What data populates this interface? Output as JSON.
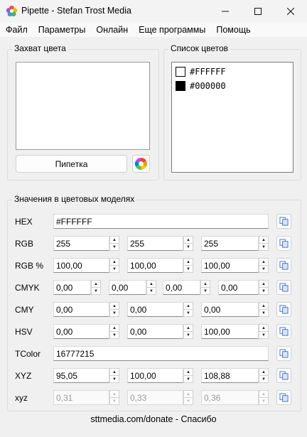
{
  "window": {
    "title": "Pipette - Stefan Trost Media"
  },
  "menu": [
    "Файл",
    "Параметры",
    "Онлайн",
    "Еще программы",
    "Помощь"
  ],
  "capture": {
    "group_label": "Захват цвета",
    "pipette_button": "Пипетка"
  },
  "colors_list": {
    "group_label": "Список цветов",
    "items": [
      {
        "hex": "#FFFFFF",
        "swatch_color": "#FFFFFF"
      },
      {
        "hex": "#000000",
        "swatch_color": "#000000"
      }
    ]
  },
  "models": {
    "group_label": "Значения в цветовых моделях",
    "hex": {
      "label": "HEX",
      "value": "#FFFFFF"
    },
    "rgb": {
      "label": "RGB",
      "values": [
        "255",
        "255",
        "255"
      ]
    },
    "rgb_pct": {
      "label": "RGB %",
      "values": [
        "100,00",
        "100,00",
        "100,00"
      ]
    },
    "cmyk": {
      "label": "CMYK",
      "values": [
        "0,00",
        "0,00",
        "0,00",
        "0,00"
      ]
    },
    "cmy": {
      "label": "CMY",
      "values": [
        "0,00",
        "0,00",
        "0,00"
      ]
    },
    "hsv": {
      "label": "HSV",
      "values": [
        "0,00",
        "0,00",
        "100,00"
      ]
    },
    "tcolor": {
      "label": "TColor",
      "value": "16777215"
    },
    "xyz": {
      "label": "XYZ",
      "values": [
        "95,05",
        "100,00",
        "108,88"
      ]
    },
    "xyz_small": {
      "label": "xyz",
      "values": [
        "0,31",
        "0,33",
        "0,36"
      ]
    }
  },
  "footer": {
    "text": "sttmedia.com/donate - Спасибо"
  }
}
